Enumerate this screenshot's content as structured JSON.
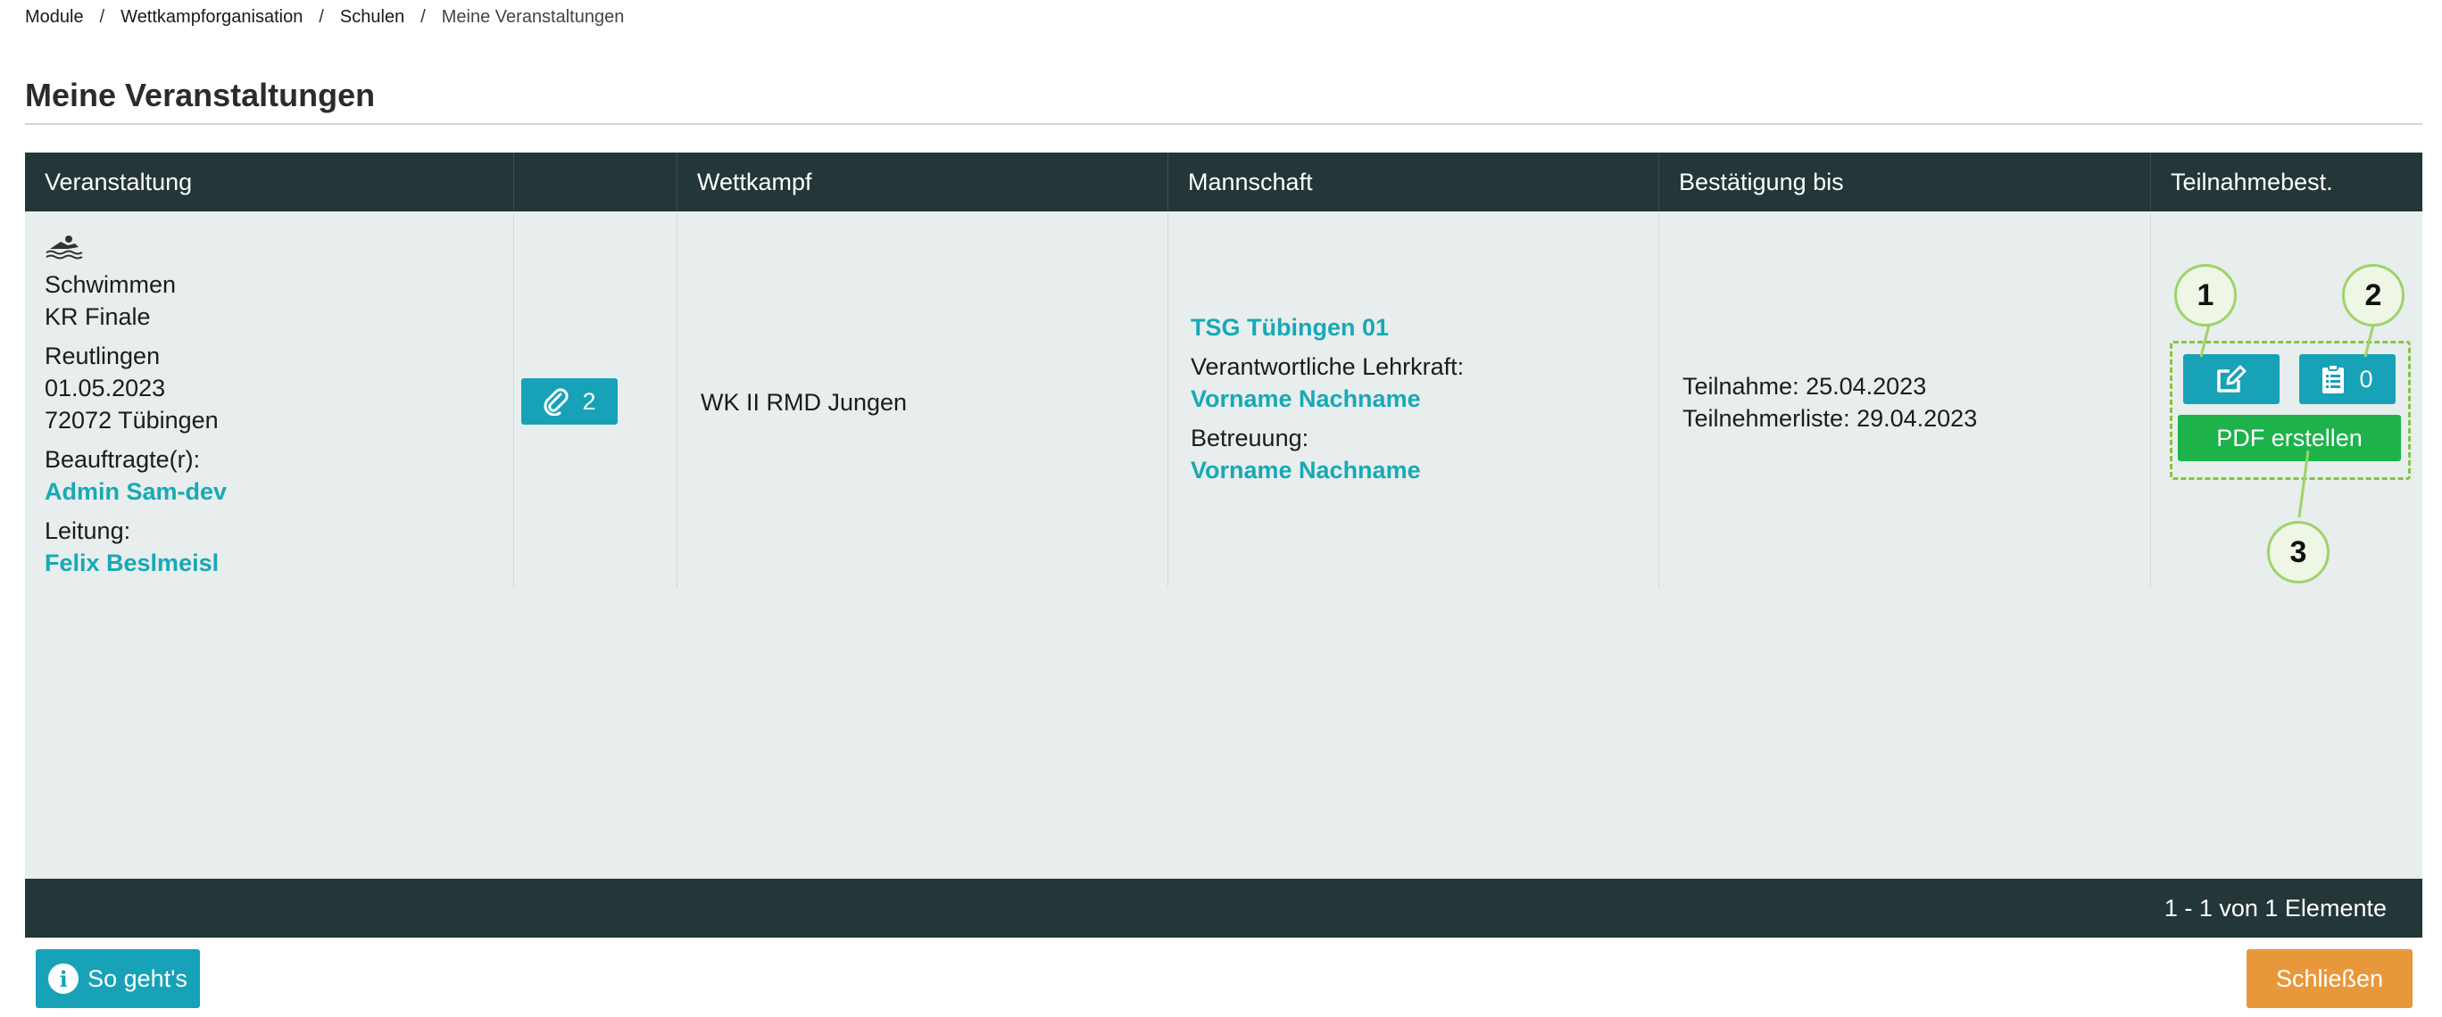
{
  "breadcrumb": [
    "Module",
    "Wettkampforganisation",
    "Schulen",
    "Meine Veranstaltungen"
  ],
  "page_title": "Meine Veranstaltungen",
  "table": {
    "headers": [
      "Veranstaltung",
      "",
      "Wettkampf",
      "Mannschaft",
      "Bestätigung bis",
      "Teilnahmebest."
    ],
    "row": {
      "sport_icon": "swimming-icon",
      "veranstaltung": {
        "sport": "Schwimmen",
        "event": "KR Finale",
        "ort": "Reutlingen",
        "datum": "01.05.2023",
        "plz_ort": "72072 Tübingen",
        "beauftragte_label": "Beauftragte(r):",
        "beauftragte_name": "Admin Sam-dev",
        "leitung_label": "Leitung:",
        "leitung_name": "Felix Beslmeisl"
      },
      "attachments": {
        "icon": "paperclip-icon",
        "count": "2"
      },
      "wettkampf": "WK II RMD Jungen",
      "mannschaft": {
        "team": "TSG Tübingen 01",
        "lehrkraft_label": "Verantwortliche Lehrkraft:",
        "lehrkraft_name": "Vorname Nachname",
        "betreuung_label": "Betreuung:",
        "betreuung_name": "Vorname Nachname"
      },
      "bestaetigung": {
        "teilnahme": "Teilnahme: 25.04.2023",
        "teilnehmerliste": "Teilnehmerliste: 29.04.2023"
      },
      "actions": {
        "edit_icon": "edit-icon",
        "list_icon": "clipboard-list-icon",
        "list_count": "0",
        "pdf_label": "PDF erstellen"
      }
    }
  },
  "callouts": [
    "1",
    "2",
    "3"
  ],
  "pager": "1 - 1 von 1 Elemente",
  "footer": {
    "help_label": "So geht's",
    "help_icon": "info-icon",
    "close_label": "Schließen"
  },
  "colors": {
    "header_bg": "#243637",
    "grid_bg": "#e8eded",
    "accent": "#17a2b8",
    "link": "#17a9b6",
    "pdf_green": "#1db34a",
    "close_orange": "#e8983b",
    "callout_green": "#86c442"
  }
}
